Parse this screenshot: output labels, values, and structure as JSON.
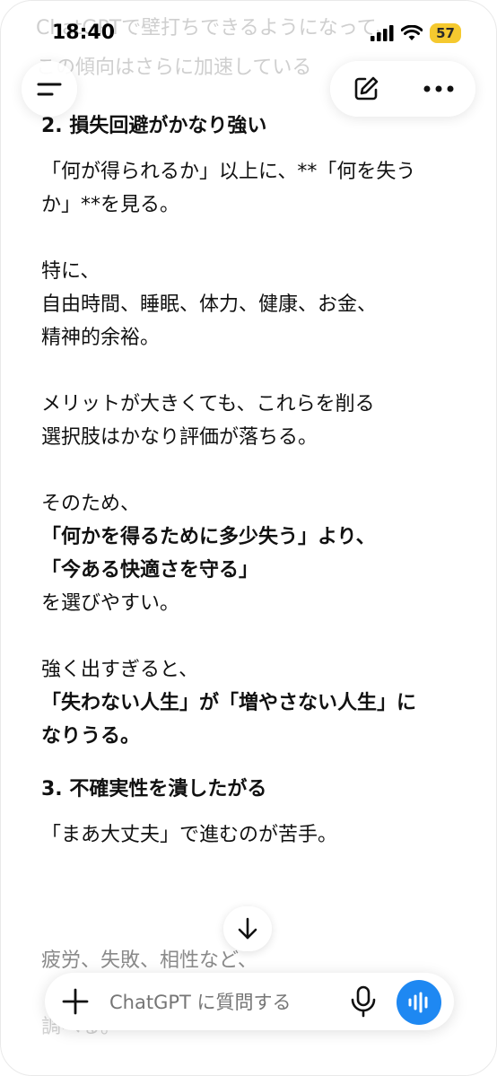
{
  "status": {
    "time": "18:40",
    "battery": "57"
  },
  "faded_top": {
    "line1": "ChatGPTで壁打ちできるようになって、",
    "line2": "この傾向はさらに加速している"
  },
  "content": {
    "heading2": "2. 損失回避がかなり強い",
    "p1_l1": "「何が得られるか」以上に、**「何を失う",
    "p1_l2": "か」**を見る。",
    "p2_l1": "特に、",
    "p2_l2": "自由時間、睡眠、体力、健康、お金、",
    "p2_l3": "精神的余裕。",
    "p3_l1": "メリットが大きくても、これらを削る",
    "p3_l2": "選択肢はかなり評価が落ちる。",
    "p4_l1": "そのため、",
    "p4_l2": "「何かを得るために多少失う」より、",
    "p4_l3": "「今ある快適さを守る」",
    "p4_l4": "を選びやすい。",
    "p5_l1": "強く出すぎると、",
    "p5_l2": "「失わない人生」が「増やさない人生」に",
    "p5_l3": "なりうる。",
    "heading3": "3. 不確実性を潰したがる",
    "p6_l1": "「まあ大丈夫」で進むのが苦手。"
  },
  "faded_bottom": {
    "line1": "疲労、失敗、相性など、",
    "line2": "調べる。"
  },
  "composer": {
    "placeholder": "ChatGPT に質問する"
  },
  "icons": {
    "menu": "menu-icon",
    "new_chat": "compose-icon",
    "more": "more-icon",
    "scroll_down": "arrow-down-icon",
    "add": "plus-icon",
    "mic": "mic-icon",
    "voice": "voice-wave-icon"
  },
  "colors": {
    "accent": "#1e88f2",
    "battery": "#f5c92f"
  }
}
